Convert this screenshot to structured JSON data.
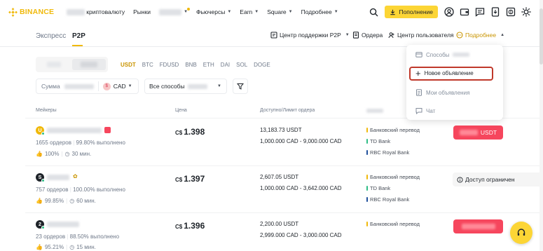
{
  "nav": {
    "brand": "BINANCE",
    "buy_crypto_label": "криптовалюту",
    "items": [
      "Рынки",
      "Фьючерсы",
      "Earn",
      "Square",
      "Подробнее"
    ],
    "deposit_label": "Пополнение"
  },
  "subheader": {
    "tabs": [
      "Экспресс",
      "P2P"
    ],
    "active_tab": "P2P",
    "support_label": "Центр поддержки P2P",
    "orders_label": "Ордера",
    "user_center_label": "Центр пользователя",
    "more_label": "Подробнее"
  },
  "filters": {
    "coins": [
      "USDT",
      "BTC",
      "FDUSD",
      "BNB",
      "ETH",
      "DAI",
      "SOL",
      "DOGE"
    ],
    "active_coin": "USDT",
    "amount_label": "Сумма",
    "currency": "CAD",
    "payment_label": "Все способы"
  },
  "table": {
    "headers": [
      "Мейкеры",
      "Цена",
      "Доступно/Лимит ордера"
    ],
    "rows": [
      {
        "avatar_letter": "U",
        "orders": "1655 ордеров",
        "completion": "99.80% выполнено",
        "rating": "100%",
        "time": "30 мин.",
        "price_currency": "C$",
        "price": "1.398",
        "available": "13,183.73 USDT",
        "limit": "1,000.000 CAD - 9,000.000 CAD",
        "payments": [
          "Банковский перевод",
          "TD Bank",
          "RBC Royal Bank"
        ],
        "action": "USDT"
      },
      {
        "avatar_letter": "S",
        "orders": "757 ордеров",
        "completion": "100.00% выполнено",
        "rating": "99.85%",
        "time": "60 мин.",
        "price_currency": "C$",
        "price": "1.397",
        "available": "2,607.05 USDT",
        "limit": "1,000.000 CAD - 3,642.000 CAD",
        "payments": [
          "Банковский перевод",
          "TD Bank",
          "RBC Royal Bank"
        ],
        "action": "Доступ ограничен"
      },
      {
        "avatar_letter": "2",
        "orders": "23 ордеров",
        "completion": "88.50% выполнено",
        "rating": "95.21%",
        "time": "15 мин.",
        "price_currency": "C$",
        "price": "1.396",
        "available": "2,200.00 USDT",
        "limit": "2,999.000 CAD - 3,000.000 CAD",
        "payments": [
          "Банковский перевод"
        ],
        "action": ""
      }
    ]
  },
  "dropdown": {
    "items": [
      "Способы",
      "Новое объявление",
      "Мои объявления",
      "Чат"
    ]
  },
  "colors": {
    "brand": "#f0b90b",
    "deposit": "#fcd535",
    "buy": "#f6465d",
    "highlight": "#c0392b",
    "online": "#2ebd85"
  }
}
